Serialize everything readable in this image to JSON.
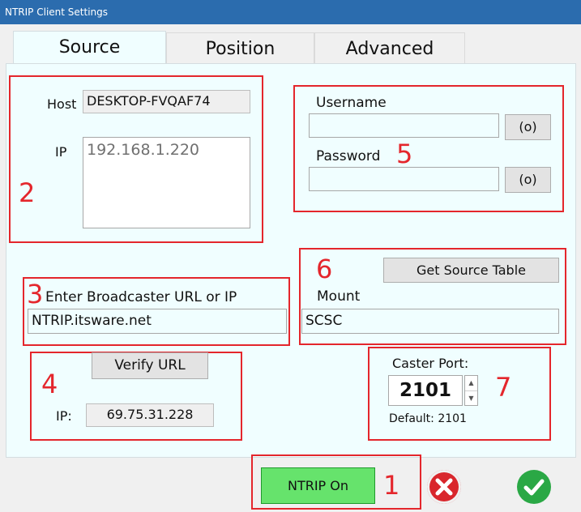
{
  "window": {
    "title": "NTRIP Client Settings"
  },
  "tabs": [
    {
      "label": "Source"
    },
    {
      "label": "Position"
    },
    {
      "label": "Advanced"
    }
  ],
  "host": {
    "label": "Host",
    "value": "DESKTOP-FVQAF74"
  },
  "ip": {
    "label": "IP",
    "value": "192.168.1.220"
  },
  "credentials": {
    "username_label": "Username",
    "password_label": "Password",
    "show_button": "(o)",
    "username_value": "",
    "password_value": ""
  },
  "broadcaster": {
    "label": "Enter Broadcaster URL or IP",
    "value": "NTRIP.itsware.net"
  },
  "mount": {
    "label": "Mount",
    "value": "SCSC",
    "get_table_button": "Get Source Table"
  },
  "verify": {
    "button": "Verify URL",
    "ip_label": "IP:",
    "ip_value": "69.75.31.228"
  },
  "caster": {
    "label": "Caster Port:",
    "value": "2101",
    "default_text": "Default: 2101"
  },
  "footer": {
    "ntrip_button": "NTRIP On"
  },
  "markers": {
    "m1": "1",
    "m2": "2",
    "m3": "3",
    "m4": "4",
    "m5": "5",
    "m6": "6",
    "m7": "7"
  },
  "colors": {
    "marker": "#e4262c",
    "ntrip_button": "#66e36c",
    "cancel": "#d9262c",
    "ok": "#2aa845"
  }
}
